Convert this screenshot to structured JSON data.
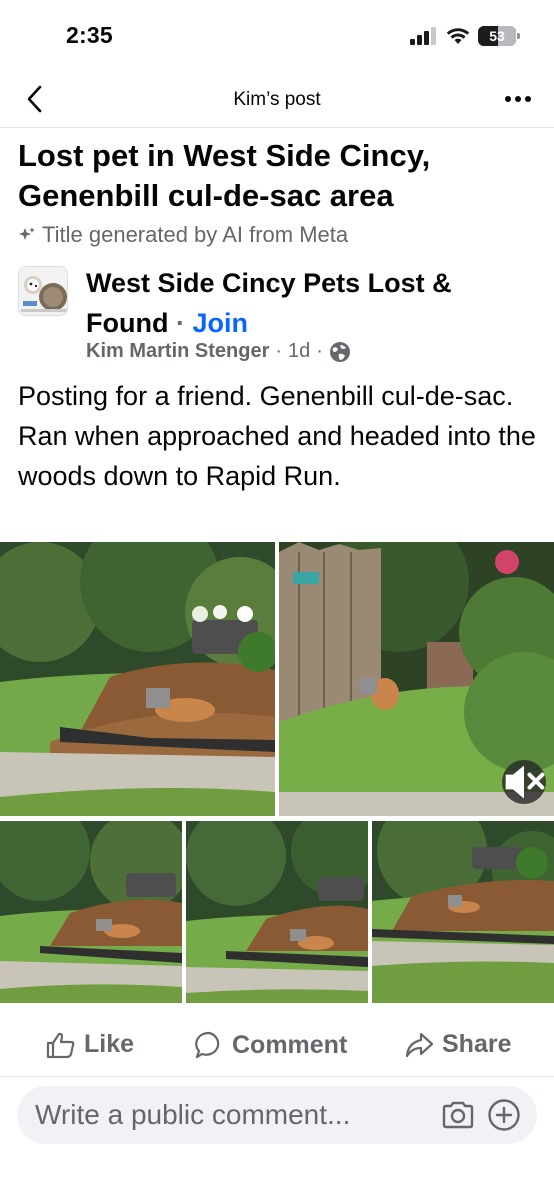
{
  "status_bar": {
    "time": "2:35",
    "battery": "53"
  },
  "nav": {
    "title": "Kim’s post"
  },
  "post": {
    "title": "Lost pet in West Side Cincy, Genenbill cul-de-sac area",
    "ai_note": "Title generated by AI from Meta",
    "group_name": "West Side Cincy Pets Lost & Found",
    "join_label": "Join",
    "separator": "·",
    "author": "Kim Martin Stenger",
    "time_ago": "1d",
    "body": "Posting for a friend.  Genenbill cul-de-sac. Ran when approached and headed into the woods down to Rapid Run."
  },
  "actions": {
    "like": "Like",
    "comment": "Comment",
    "share": "Share"
  },
  "composer": {
    "placeholder": "Write a public comment..."
  },
  "colors": {
    "link_blue": "#0866ff",
    "secondary_text": "#65676b",
    "composer_bg": "#f0f2f5"
  }
}
